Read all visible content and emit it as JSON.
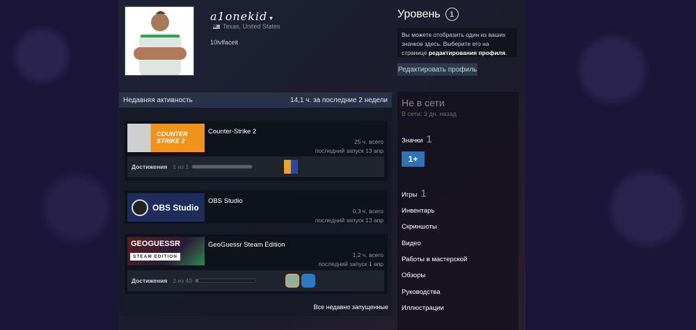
{
  "profile": {
    "name": "a1onekid",
    "location": "Texas, United States",
    "summary": "10lvlfaceit"
  },
  "level": {
    "label": "Уровень",
    "value": "1"
  },
  "badge_info": {
    "text": "Вы можете отобразить один из ваших значков здесь. Выберите его на странице ",
    "link": "редактирования профиля",
    "end": "."
  },
  "edit_profile_label": "Редактировать профиль",
  "status": {
    "state": "Не в сети",
    "last_online": "В сети: 3 дн. назад"
  },
  "sidebar": {
    "badges_label": "Значки",
    "badges_count": "1",
    "badge_text": "1+",
    "games_label": "Игры",
    "games_count": "1",
    "links": [
      "Инвентарь",
      "Скриншоты",
      "Видео",
      "Работы в мастерской",
      "Обзоры",
      "Руководства",
      "Иллюстрации"
    ]
  },
  "recent": {
    "title": "Недавняя активность",
    "hours": "14,1 ч. за последние 2 недели",
    "all_label": "Все недавно запущенные",
    "achievements_label": "Достижения",
    "games": [
      {
        "name": "Counter-Strike 2",
        "logo": "COUNTER STRIKE 2",
        "total": "25 ч. всего",
        "last": "последний запуск 13 апр",
        "achievements": "1 из 1",
        "progress": 1.0
      },
      {
        "name": "OBS Studio",
        "logo": "OBS Studio",
        "total": "0,3 ч. всего",
        "last": "последний запуск 13 апр"
      },
      {
        "name": "GeoGuessr Steam Edition",
        "logo": "GEOGUESSR",
        "logo_sub": "STEAM EDITION",
        "total": "1,2 ч. всего",
        "last": "последний запуск 1 апр",
        "achievements": "2 из 40",
        "progress": 0.05
      }
    ]
  },
  "colors": {
    "accent": "#2d73b5",
    "cs_orange": "#f0931c",
    "obs_blue": "#1f2d5c"
  }
}
